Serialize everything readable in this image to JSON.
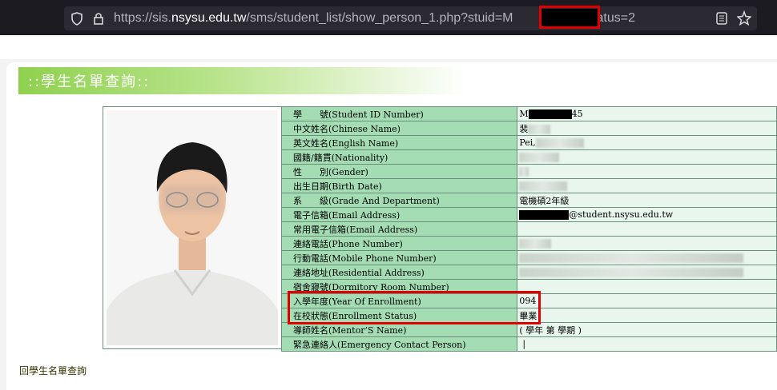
{
  "browser": {
    "url_prefix": "https://sis.",
    "url_host": "nsysu.edu.tw",
    "url_path_a": "/sms/student_list/show_person_1.php?stuid=M",
    "url_path_b": "5&status=2"
  },
  "page": {
    "title": "::學生名單查詢::",
    "back_link": "回學生名單查詢"
  },
  "student": {
    "rows": [
      {
        "label": "學　　號(Student ID Number)",
        "value_prefix": "M",
        "value_suffix": "45"
      },
      {
        "label": "中文姓名(Chinese Name)",
        "value_prefix": "裴",
        "value_suffix": ""
      },
      {
        "label": "英文姓名(English Name)",
        "value_prefix": "Pei,",
        "value_suffix": ""
      },
      {
        "label": "國籍/籍貫(Nationality)",
        "value_prefix": "",
        "value_suffix": ""
      },
      {
        "label": "性　　別(Gender)",
        "value_prefix": "",
        "value_suffix": ""
      },
      {
        "label": "出生日期(Birth Date)",
        "value_prefix": "",
        "value_suffix": ""
      },
      {
        "label": "系　　級(Grade And Department)",
        "value_prefix": "電機碩2年級",
        "value_suffix": ""
      },
      {
        "label": "電子信箱(Email Address)",
        "value_prefix": "",
        "value_suffix": "@student.nsysu.edu.tw"
      },
      {
        "label": "常用電子信箱(Email Address)",
        "value_prefix": "",
        "value_suffix": ""
      },
      {
        "label": "連絡電話(Phone Number)",
        "value_prefix": "",
        "value_suffix": ""
      },
      {
        "label": "行動電話(Mobile Phone Number)",
        "value_prefix": "",
        "value_suffix": ""
      },
      {
        "label": "連絡地址(Residential Address)",
        "value_prefix": "",
        "value_suffix": ""
      },
      {
        "label": "宿舍寢號(Dormitory Room Number)",
        "value_prefix": "",
        "value_suffix": ""
      },
      {
        "label": "入學年度(Year Of Enrollment)",
        "value_prefix": "094",
        "value_suffix": ""
      },
      {
        "label": "在校狀態(Enrollment Status)",
        "value_prefix": "畢業",
        "value_suffix": ""
      },
      {
        "label": "導師姓名(Mentor’S Name)",
        "value_prefix": "( 學年 第 學期 )",
        "value_suffix": ""
      },
      {
        "label": "緊急連絡人(Emergency Contact Person)",
        "value_prefix": "|",
        "value_suffix": ""
      }
    ]
  },
  "icons": [
    "shield-icon",
    "lock-icon",
    "reader-view-icon",
    "bookmark-star-icon"
  ]
}
